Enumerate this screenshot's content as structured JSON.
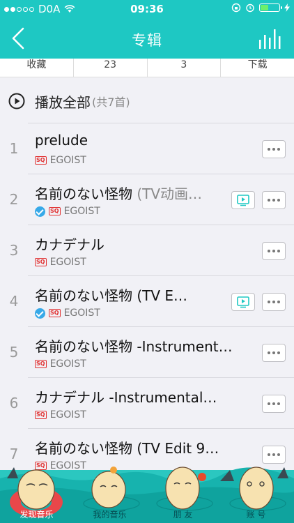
{
  "status": {
    "carrier": "D0A",
    "time": "09:36",
    "signal_full": 2,
    "signal_total": 5
  },
  "header": {
    "title": "专辑"
  },
  "stats": {
    "items": [
      "收藏",
      "23",
      "3",
      "下载"
    ]
  },
  "play_all": {
    "label": "播放全部",
    "count": "(共7首)"
  },
  "songs": [
    {
      "index": "1",
      "title": "prelude",
      "extra": "",
      "artist": "EGOIST",
      "quality": "SQ",
      "verified": false,
      "has_mv": false
    },
    {
      "index": "2",
      "title": "名前のない怪物 ",
      "extra": "(TV动画…",
      "artist": "EGOIST",
      "quality": "SQ",
      "verified": true,
      "has_mv": true
    },
    {
      "index": "3",
      "title": "カナデナル",
      "extra": "",
      "artist": "EGOIST",
      "quality": "SQ",
      "verified": false,
      "has_mv": false
    },
    {
      "index": "4",
      "title": "名前のない怪物 (TV E…",
      "extra": "",
      "artist": "EGOIST",
      "quality": "SQ",
      "verified": true,
      "has_mv": true
    },
    {
      "index": "5",
      "title": "名前のない怪物 -Instrument…",
      "extra": "",
      "artist": "EGOIST",
      "quality": "SQ",
      "verified": false,
      "has_mv": false
    },
    {
      "index": "6",
      "title": "カナデナル -Instrumental…",
      "extra": "",
      "artist": "EGOIST",
      "quality": "SQ",
      "verified": false,
      "has_mv": false
    },
    {
      "index": "7",
      "title": "名前のない怪物 (TV Edit 9…",
      "extra": "",
      "artist": "EGOIST",
      "quality": "SQ",
      "verified": false,
      "has_mv": false
    }
  ],
  "nav": {
    "items": [
      "发现音乐",
      "我的音乐",
      "朋 友",
      "账 号"
    ],
    "active": 0
  },
  "colors": {
    "accent": "#1ec8c3",
    "quality": "#e13030",
    "verified": "#37a9e8"
  },
  "icons": {
    "back": "chevron-left-icon",
    "playing": "bar-chart-icon",
    "play": "play-circle-icon",
    "mv": "mv-icon",
    "more": "more-icon"
  }
}
